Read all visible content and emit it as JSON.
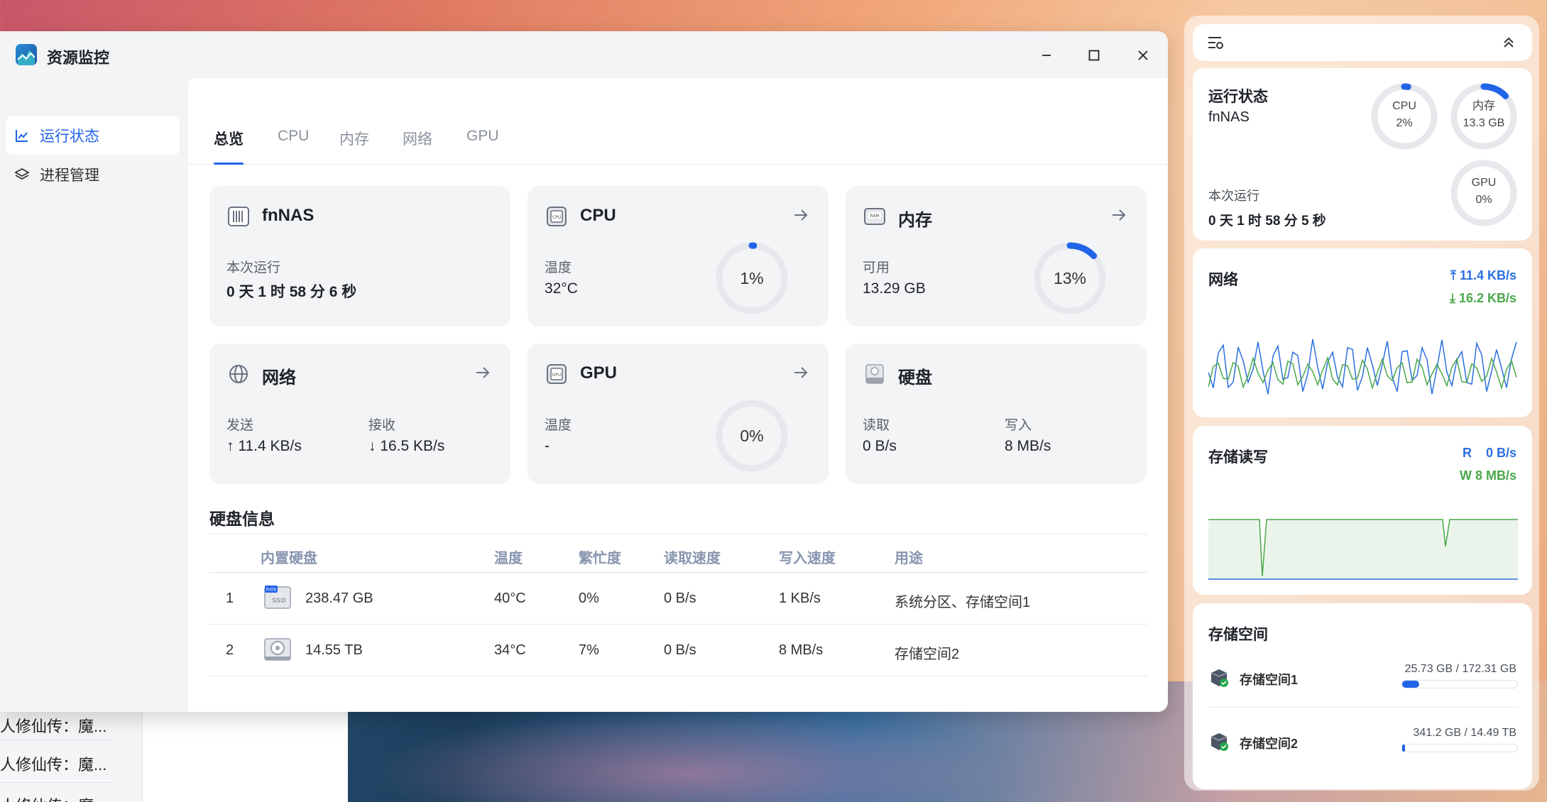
{
  "window": {
    "title": "资源监控",
    "minimize_label": "minimize",
    "maximize_label": "maximize",
    "close_label": "close"
  },
  "sidebar": {
    "items": [
      {
        "label": "运行状态",
        "icon": "line-chart-icon",
        "active": true
      },
      {
        "label": "进程管理",
        "icon": "layers-icon",
        "active": false
      }
    ]
  },
  "tabs": [
    "总览",
    "CPU",
    "内存",
    "网络",
    "GPU"
  ],
  "cards": {
    "system": {
      "title": "fnNAS",
      "label": "本次运行",
      "value": "0 天 1 时 58 分 6 秒"
    },
    "cpu": {
      "title": "CPU",
      "label": "温度",
      "value": "32°C",
      "gauge": "1%",
      "gauge_fraction": 0.01
    },
    "memory": {
      "title": "内存",
      "label": "可用",
      "value": "13.29 GB",
      "gauge": "13%",
      "gauge_fraction": 0.13
    },
    "network": {
      "title": "网络",
      "send_label": "发送",
      "send_value": "↑ 11.4 KB/s",
      "recv_label": "接收",
      "recv_value": "↓ 16.5 KB/s"
    },
    "gpu": {
      "title": "GPU",
      "label": "温度",
      "value": "-",
      "gauge": "0%",
      "gauge_fraction": 0.0
    },
    "disk": {
      "title": "硬盘",
      "read_label": "读取",
      "read_value": "0 B/s",
      "write_label": "写入",
      "write_value": "8 MB/s"
    }
  },
  "disk_info": {
    "title": "硬盘信息",
    "columns": [
      "内置硬盘",
      "温度",
      "繁忙度",
      "读取速度",
      "写入速度",
      "用途"
    ],
    "rows": [
      {
        "index": "1",
        "size": "238.47 GB",
        "temp": "40°C",
        "busy": "0%",
        "read": "0 B/s",
        "write": "1 KB/s",
        "usage": "系统分区、存储空间1",
        "icon": "ssd-icon",
        "icon_badge": "fnOS",
        "icon_label": "SSD"
      },
      {
        "index": "2",
        "size": "14.55 TB",
        "temp": "34°C",
        "busy": "7%",
        "read": "0 B/s",
        "write": "8 MB/s",
        "usage": "存储空间2",
        "icon": "hdd-icon"
      }
    ]
  },
  "widgets": {
    "status": {
      "title": "运行状态",
      "host": "fnNAS",
      "cpu_label": "CPU",
      "cpu_value": "2%",
      "cpu_fraction": 0.02,
      "mem_label": "内存",
      "mem_value": "13.3 GB",
      "mem_fraction": 0.13,
      "gpu_label": "GPU",
      "gpu_value": "0%",
      "gpu_fraction": 0.0,
      "uptime_label": "本次运行",
      "uptime_value": "0 天 1 时 58 分 5 秒"
    },
    "network": {
      "title": "网络",
      "up": "11.4 KB/s",
      "down": "16.2 KB/s"
    },
    "storage_io": {
      "title": "存储读写",
      "r_label": "R",
      "r_value": "0 B/s",
      "w_label": "W",
      "w_value": "8 MB/s"
    },
    "storage_space": {
      "title": "存储空间",
      "items": [
        {
          "name": "存储空间1",
          "usage": "25.73 GB / 172.31 GB",
          "fraction": 0.149
        },
        {
          "name": "存储空间2",
          "usage": "341.2 GB / 14.49 TB",
          "fraction": 0.023
        }
      ]
    }
  },
  "background_app": {
    "items": [
      "人修仙传：魔...",
      "人修仙传：魔...",
      "人修仙传：魔"
    ]
  },
  "colors": {
    "accent": "#2164e8",
    "net_up": "#2b6fe0",
    "net_down": "#4aa84a"
  }
}
